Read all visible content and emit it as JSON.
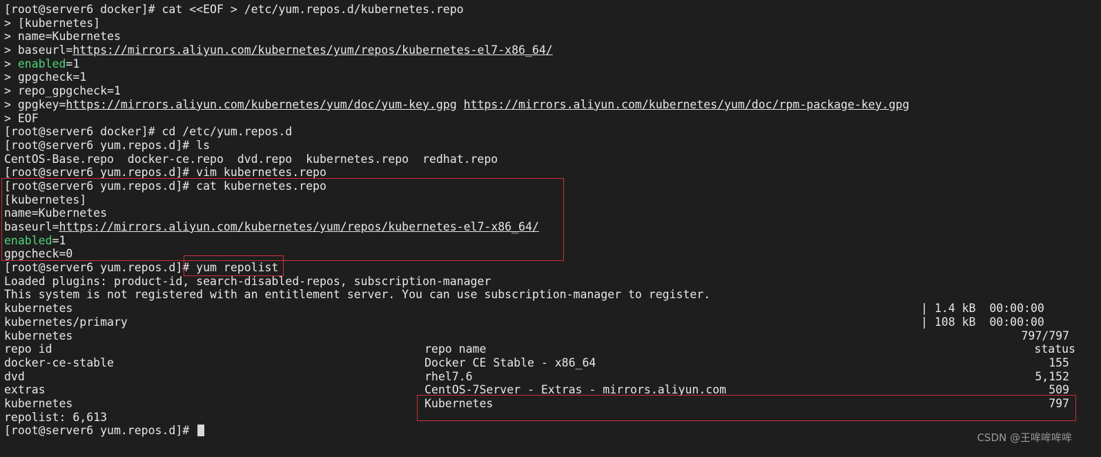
{
  "prompt": "[root@server6 docker]# ",
  "prompt_d": "[root@server6 yum.repos.d]# ",
  "heredoc": {
    "cmd": "cat <<EOF > /etc/yum.repos.d/kubernetes.repo",
    "section": "> [kubernetes]",
    "name": "> name=Kubernetes",
    "baseurl_key": "> baseurl=",
    "baseurl": "https://mirrors.aliyun.com/kubernetes/yum/repos/kubernetes-el7-x86_64/",
    "enabled_prefix": "> ",
    "enabled_key": "enabled",
    "enabled_val": "=1",
    "gpgcheck": "> gpgcheck=1",
    "repo_gpgcheck": "> repo_gpgcheck=1",
    "gpgkey_key": "> gpgkey=",
    "gpgkey_url1": "https://mirrors.aliyun.com/kubernetes/yum/doc/yum-key.gpg",
    "gpgkey_url2": "https://mirrors.aliyun.com/kubernetes/yum/doc/rpm-package-key.gpg",
    "eof": "> EOF"
  },
  "cmds": {
    "cd": "cd /etc/yum.repos.d",
    "ls": "ls",
    "vim": "vim kubernetes.repo",
    "cat": "cat kubernetes.repo",
    "repolist": "yum repolist"
  },
  "ls_output": "CentOS-Base.repo  docker-ce.repo  dvd.repo  kubernetes.repo  redhat.repo",
  "file": {
    "section": "[kubernetes]",
    "name": "name=Kubernetes",
    "baseurl_key": "baseurl=",
    "baseurl": "https://mirrors.aliyun.com/kubernetes/yum/repos/kubernetes-el7-x86_64/",
    "enabled_key": "enabled",
    "enabled_val": "=1",
    "gpgcheck": "gpgcheck=0"
  },
  "yum": {
    "plugins": "Loaded plugins: product-id, search-disabled-repos, subscription-manager",
    "notice": "This system is not registered with an entitlement server. You can use subscription-manager to register.",
    "downloads": [
      {
        "name": "kubernetes",
        "size": "| 1.4 kB  00:00:00"
      },
      {
        "name": "kubernetes/primary",
        "size": "| 108 kB  00:00:00"
      }
    ],
    "progress_name": "kubernetes",
    "progress": "797/797",
    "headers": {
      "id": "repo id",
      "name": "repo name",
      "status": "status"
    },
    "rows": [
      {
        "id": "docker-ce-stable",
        "name": "Docker CE Stable - x86_64",
        "status": "155"
      },
      {
        "id": "dvd",
        "name": "rhel7.6",
        "status": "5,152"
      },
      {
        "id": "extras",
        "name": "CentOS-7Server - Extras - mirrors.aliyun.com",
        "status": "509"
      },
      {
        "id": "kubernetes",
        "name": "Kubernetes",
        "status": "797"
      }
    ],
    "total": "repolist: 6,613"
  },
  "watermark": "CSDN @王哞哞哞哞",
  "colors": {
    "background": "#1e1e1e",
    "text": "#e8e8e8",
    "green": "#4fd47a",
    "highlight": "#d0303a"
  }
}
